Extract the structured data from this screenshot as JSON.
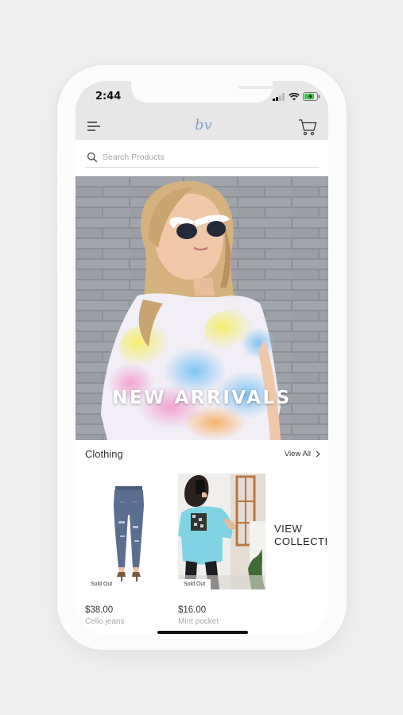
{
  "status_bar": {
    "time": "2:44"
  },
  "header": {
    "logo_text": "bv",
    "accent": "#8aa3c9"
  },
  "search": {
    "placeholder": "Search Products"
  },
  "hero": {
    "title": "NEW ARRIVALS"
  },
  "section": {
    "title": "Clothing",
    "view_all_label": "View All"
  },
  "products": [
    {
      "price": "$38.00",
      "name": "Cello jeans",
      "badge": "Sold Out",
      "icon": "jeans-image"
    },
    {
      "price": "$16.00",
      "name": "Mint pocket",
      "badge": "Sold Out",
      "icon": "tee-image"
    }
  ],
  "view_collection": {
    "line1": "VIEW",
    "line2": "COLLECTION"
  }
}
